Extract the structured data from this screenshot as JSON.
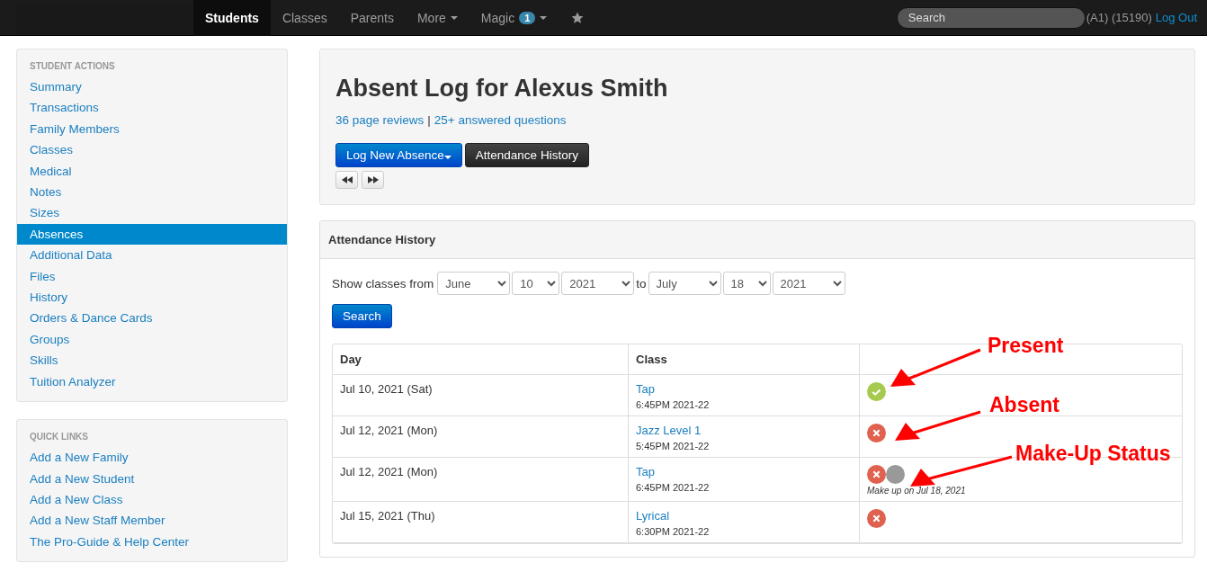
{
  "navbar": {
    "items": [
      {
        "label": "Students",
        "selected": true,
        "dropdown": false
      },
      {
        "label": "Classes",
        "selected": false,
        "dropdown": false
      },
      {
        "label": "Parents",
        "selected": false,
        "dropdown": false
      },
      {
        "label": "More",
        "selected": false,
        "dropdown": true
      },
      {
        "label": "Magic",
        "selected": false,
        "dropdown": true,
        "badge": "1"
      }
    ],
    "search": {
      "placeholder": "Search"
    },
    "account": "(A1) (15190)",
    "logout": "Log Out"
  },
  "sidebar": {
    "sections": [
      {
        "title": "STUDENT ACTIONS",
        "items": [
          {
            "label": "Summary",
            "selected": false
          },
          {
            "label": "Transactions",
            "selected": false
          },
          {
            "label": "Family Members",
            "selected": false
          },
          {
            "label": "Classes",
            "selected": false
          },
          {
            "label": "Medical",
            "selected": false
          },
          {
            "label": "Notes",
            "selected": false
          },
          {
            "label": "Sizes",
            "selected": false
          },
          {
            "label": "Absences",
            "selected": true
          },
          {
            "label": "Additional Data",
            "selected": false
          },
          {
            "label": "Files",
            "selected": false
          },
          {
            "label": "History",
            "selected": false
          },
          {
            "label": "Orders & Dance Cards",
            "selected": false
          },
          {
            "label": "Groups",
            "selected": false
          },
          {
            "label": "Skills",
            "selected": false
          },
          {
            "label": "Tuition Analyzer",
            "selected": false
          }
        ]
      },
      {
        "title": "QUICK LINKS",
        "items": [
          {
            "label": "Add a New Family",
            "selected": false
          },
          {
            "label": "Add a New Student",
            "selected": false
          },
          {
            "label": "Add a New Class",
            "selected": false
          },
          {
            "label": "Add a New Staff Member",
            "selected": false
          },
          {
            "label": "The Pro-Guide & Help Center",
            "selected": false
          }
        ]
      }
    ]
  },
  "header": {
    "title": "Absent Log for Alexus Smith",
    "links": [
      "36 page reviews",
      "25+ answered questions"
    ],
    "separator": "|",
    "buttons": [
      {
        "label": "Log New Absence",
        "kind": "primary",
        "dropdown": true
      },
      {
        "label": "Attendance History",
        "kind": "dark",
        "dropdown": false
      }
    ]
  },
  "history": {
    "title": "Attendance History",
    "filter": {
      "label": "Show classes from",
      "from": [
        "June",
        "10",
        "2021"
      ],
      "to_label": "to",
      "to": [
        "July",
        "18",
        "2021"
      ],
      "button": "Search"
    },
    "columns": [
      "Day",
      "Class"
    ],
    "rows": [
      {
        "day": "Jul 10, 2021 (Sat)",
        "class": "Tap",
        "time": "6:45PM 2021-22",
        "statuses": [
          {
            "kind": "present"
          }
        ]
      },
      {
        "day": "Jul 12, 2021 (Mon)",
        "class": "Jazz Level 1",
        "time": "5:45PM 2021-22",
        "statuses": [
          {
            "kind": "absent"
          }
        ]
      },
      {
        "day": "Jul 12, 2021 (Mon)",
        "class": "Tap",
        "time": "6:45PM 2021-22",
        "statuses": [
          {
            "kind": "absent"
          },
          {
            "kind": "makeup"
          }
        ],
        "note": "Make up on Jul 18, 2021"
      },
      {
        "day": "Jul 15, 2021 (Thu)",
        "class": "Lyrical",
        "time": "6:30PM 2021-22",
        "statuses": [
          {
            "kind": "absent"
          }
        ]
      }
    ]
  },
  "annotations": [
    "Present",
    "Absent",
    "Make-Up Status"
  ]
}
